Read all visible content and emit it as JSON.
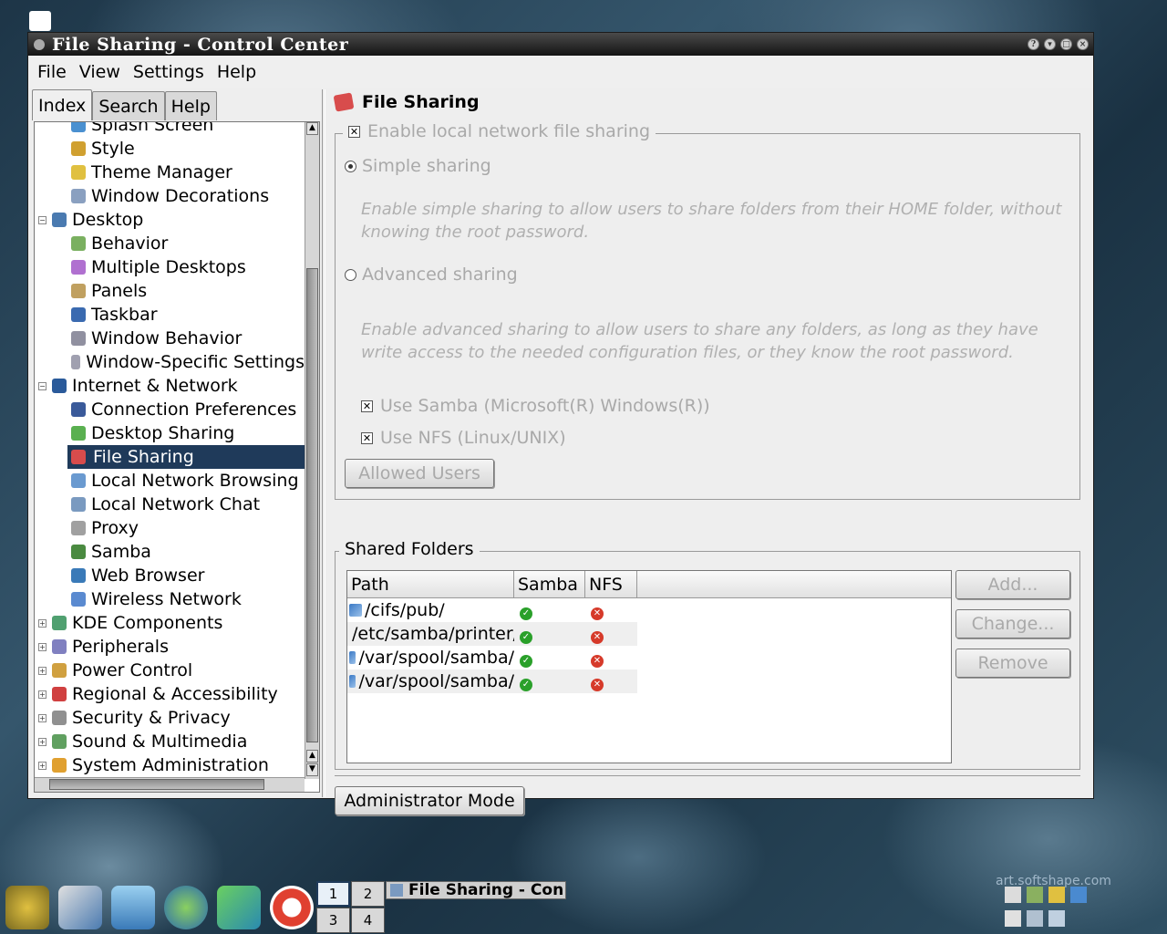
{
  "window": {
    "title": "File Sharing - Control Center"
  },
  "menu": {
    "items": [
      "File",
      "View",
      "Settings",
      "Help"
    ]
  },
  "tabs": [
    "Index",
    "Search",
    "Help"
  ],
  "tree": [
    {
      "label": "Splash Screen",
      "level": 2
    },
    {
      "label": "Style",
      "level": 2
    },
    {
      "label": "Theme Manager",
      "level": 2
    },
    {
      "label": "Window Decorations",
      "level": 2
    },
    {
      "label": "Desktop",
      "level": 1,
      "expanded": true
    },
    {
      "label": "Behavior",
      "level": 2
    },
    {
      "label": "Multiple Desktops",
      "level": 2
    },
    {
      "label": "Panels",
      "level": 2
    },
    {
      "label": "Taskbar",
      "level": 2
    },
    {
      "label": "Window Behavior",
      "level": 2
    },
    {
      "label": "Window-Specific Settings",
      "level": 2
    },
    {
      "label": "Internet & Network",
      "level": 1,
      "expanded": true
    },
    {
      "label": "Connection Preferences",
      "level": 2
    },
    {
      "label": "Desktop Sharing",
      "level": 2
    },
    {
      "label": "File Sharing",
      "level": 2,
      "selected": true
    },
    {
      "label": "Local Network Browsing",
      "level": 2
    },
    {
      "label": "Local Network Chat",
      "level": 2
    },
    {
      "label": "Proxy",
      "level": 2
    },
    {
      "label": "Samba",
      "level": 2
    },
    {
      "label": "Web Browser",
      "level": 2
    },
    {
      "label": "Wireless Network",
      "level": 2
    },
    {
      "label": "KDE Components",
      "level": 1
    },
    {
      "label": "Peripherals",
      "level": 1
    },
    {
      "label": "Power Control",
      "level": 1
    },
    {
      "label": "Regional & Accessibility",
      "level": 1
    },
    {
      "label": "Security & Privacy",
      "level": 1
    },
    {
      "label": "Sound & Multimedia",
      "level": 1
    },
    {
      "label": "System Administration",
      "level": 1
    }
  ],
  "module": {
    "title": "File Sharing",
    "enable_label": "Enable local network file sharing",
    "simple_label": "Simple sharing",
    "simple_desc": "Enable simple sharing to allow users to share folders from their HOME folder, without knowing the root password.",
    "advanced_label": "Advanced sharing",
    "advanced_desc": "Enable advanced sharing to allow users to share any folders, as long as they have write access to the needed configuration files, or they know the root password.",
    "samba_label": "Use Samba (Microsoft(R) Windows(R))",
    "nfs_label": "Use NFS (Linux/UNIX)",
    "allowed_users": "Allowed Users",
    "shared_title": "Shared Folders",
    "columns": [
      "Path",
      "Samba",
      "NFS"
    ],
    "rows": [
      {
        "path": "/cifs/pub/"
      },
      {
        "path": "/etc/samba/printer/"
      },
      {
        "path": "/var/spool/samba/"
      },
      {
        "path": "/var/spool/samba/"
      }
    ],
    "add": "Add...",
    "change": "Change...",
    "remove": "Remove",
    "admin_mode": "Administrator Mode"
  },
  "taskbar": {
    "pager": [
      "1",
      "2",
      "3",
      "4"
    ],
    "task": "File Sharing - Con",
    "watermark": "art.softshape.com"
  },
  "colors": {
    "selection": "#1f3a5a",
    "ok": "#2aa02a",
    "error": "#d63a2a"
  }
}
